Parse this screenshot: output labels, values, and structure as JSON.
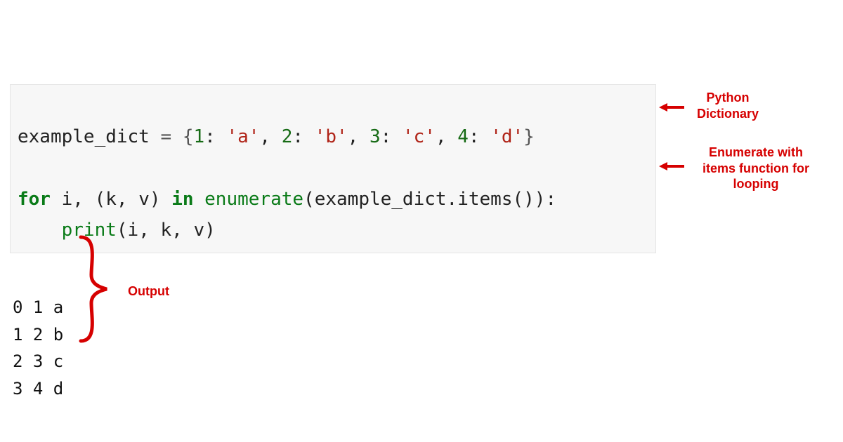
{
  "colors": {
    "annotation": "#d60000",
    "code_bg": "#f7f7f7",
    "keyword": "#0a7b18",
    "number": "#176b16",
    "string": "#b02418"
  },
  "code": {
    "line1": {
      "var": "example_dict",
      "eq": " = ",
      "open": "{",
      "k1": "1",
      "c1": ": ",
      "v1": "'a'",
      "s1": ", ",
      "k2": "2",
      "c2": ": ",
      "v2": "'b'",
      "s2": ", ",
      "k3": "3",
      "c3": ": ",
      "v3": "'c'",
      "s3": ", ",
      "k4": "4",
      "c4": ": ",
      "v4": "'d'",
      "close": "}"
    },
    "blank": "",
    "line3": {
      "for": "for",
      "sp1": " ",
      "i": "i",
      "sp2": ", (",
      "k": "k",
      "sp3": ", ",
      "v": "v",
      "sp4": ") ",
      "in": "in",
      "sp5": " ",
      "enumerate": "enumerate",
      "open": "(",
      "obj": "example_dict",
      "dot": ".",
      "items": "items",
      "call": "()):"
    },
    "line4": {
      "indent": "    ",
      "print": "print",
      "args": "(i, k, v)"
    }
  },
  "output": {
    "l1": "0 1 a",
    "l2": "1 2 b",
    "l3": "2 3 c",
    "l4": "3 4 d"
  },
  "annotations": {
    "dict": {
      "l1": "Python",
      "l2": "Dictionary"
    },
    "enum": {
      "l1": "Enumerate with",
      "l2": "items function for",
      "l3": "looping"
    },
    "output_label": "Output"
  }
}
